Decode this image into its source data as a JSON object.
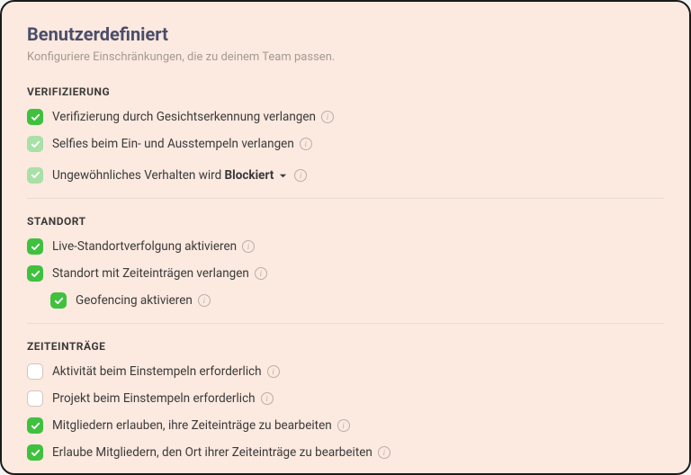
{
  "header": {
    "title": "Benutzerdefiniert",
    "subtitle": "Konfiguriere Einschränkungen, die zu deinem Team passen."
  },
  "sections": {
    "verification": {
      "title": "VERIFIZIERUNG",
      "items": {
        "face": "Verifizierung durch Gesichtserkennung verlangen",
        "selfies": "Selfies beim Ein- und Ausstempeln verlangen",
        "unusual_prefix": "Ungewöhnliches Verhalten wird ",
        "unusual_value": "Blockiert"
      }
    },
    "location": {
      "title": "STANDORT",
      "items": {
        "live": "Live-Standortverfolgung aktivieren",
        "require": "Standort mit Zeiteinträgen verlangen",
        "geofencing": "Geofencing aktivieren"
      }
    },
    "time": {
      "title": "ZEITEINTRÄGE",
      "items": {
        "activity": "Aktivität beim Einstempeln erforderlich",
        "project": "Projekt beim Einstempeln erforderlich",
        "edit_entries": "Mitgliedern erlauben, ihre Zeiteinträge zu bearbeiten",
        "edit_location": "Erlaube Mitgliedern, den Ort ihrer Zeiteinträge zu bearbeiten"
      }
    }
  },
  "icons": {
    "info": "i"
  }
}
